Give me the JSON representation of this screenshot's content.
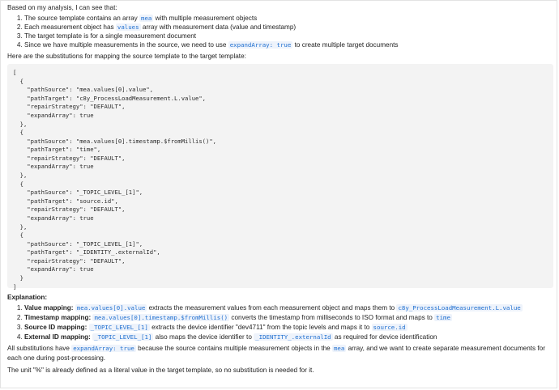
{
  "intro_text": "Based on my analysis, I can see that:",
  "analysis_points": [
    {
      "before": "The source template contains an array ",
      "code": "mea",
      "after": " with multiple measurement objects"
    },
    {
      "before": "Each measurement object has ",
      "code": "values",
      "after": " array with measurement data (value and timestamp)"
    },
    {
      "before": "The target template is for a single measurement document",
      "code": "",
      "after": ""
    },
    {
      "before": "Since we have multiple measurements in the source, we need to use ",
      "code": "expandArray: true",
      "after": " to create multiple target documents"
    }
  ],
  "substitutions_heading": "Here are the substitutions for mapping the source template to the target template:",
  "code_block": "[\n  {\n    \"pathSource\": \"mea.values[0].value\",\n    \"pathTarget\": \"c8y_ProcessLoadMeasurement.L.value\",\n    \"repairStrategy\": \"DEFAULT\",\n    \"expandArray\": true\n  },\n  {\n    \"pathSource\": \"mea.values[0].timestamp.$fromMillis()\",\n    \"pathTarget\": \"time\",\n    \"repairStrategy\": \"DEFAULT\",\n    \"expandArray\": true\n  },\n  {\n    \"pathSource\": \"_TOPIC_LEVEL_[1]\",\n    \"pathTarget\": \"source.id\",\n    \"repairStrategy\": \"DEFAULT\",\n    \"expandArray\": true\n  },\n  {\n    \"pathSource\": \"_TOPIC_LEVEL_[1]\",\n    \"pathTarget\": \"_IDENTITY_.externalId\",\n    \"repairStrategy\": \"DEFAULT\",\n    \"expandArray\": true\n  }\n]",
  "explanation_heading": "Explanation:",
  "explanation_items": [
    {
      "title": "Value mapping:",
      "code1": "mea.values[0].value",
      "mid": " extracts the measurement values from each measurement object and maps them to ",
      "code2": "c8y_ProcessLoadMeasurement.L.value",
      "end": ""
    },
    {
      "title": "Timestamp mapping:",
      "code1": "mea.values[0].timestamp.$fromMillis()",
      "mid": " converts the timestamp from milliseconds to ISO format and maps to ",
      "code2": "time",
      "end": ""
    },
    {
      "title": "Source ID mapping:",
      "code1": "_TOPIC_LEVEL_[1]",
      "mid": " extracts the device identifier \"dev4711\" from the topic levels and maps it to ",
      "code2": "source.id",
      "end": ""
    },
    {
      "title": "External ID mapping:",
      "code1": "_TOPIC_LEVEL_[1]",
      "mid": " also maps the device identifier to ",
      "code2": "_IDENTITY_.externalId",
      "end": " as required for device identification"
    }
  ],
  "summary": {
    "before": "All substitutions have ",
    "code1": "expandArray: true",
    "mid": " because the source contains multiple measurement objects in the ",
    "code2": "mea",
    "after": " array, and we want to create separate measurement documents for each one during post-processing."
  },
  "unit_note": "The unit \"%\" is already defined as a literal value in the target template, so no substitution is needed for it."
}
